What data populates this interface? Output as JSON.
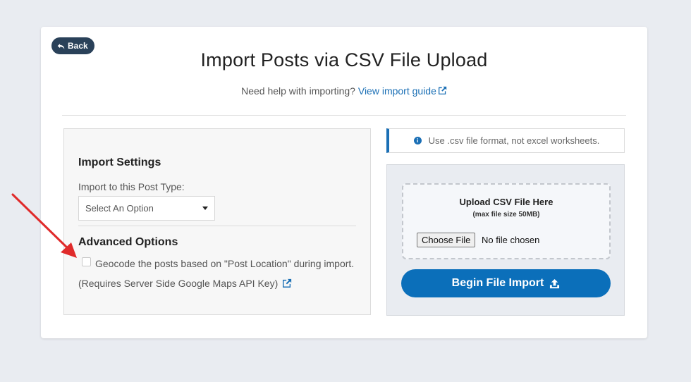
{
  "header": {
    "back_label": "Back",
    "title": "Import Posts via CSV File Upload",
    "help_text": "Need help with importing?",
    "help_link": "View import guide"
  },
  "settings": {
    "section_title": "Import Settings",
    "post_type_label": "Import to this Post Type:",
    "post_type_selected": "Select An Option"
  },
  "advanced": {
    "section_title": "Advanced Options",
    "geocode_label": "Geocode the posts based on \"Post Location\" during import. (Requires Server Side Google Maps API Key)",
    "geocode_checked": false
  },
  "info": {
    "message": "Use .csv file format, not excel worksheets."
  },
  "upload": {
    "title": "Upload CSV File Here",
    "subtitle": "(max file size 50MB)",
    "choose_label": "Choose File",
    "file_status": "No file chosen",
    "begin_label": "Begin File Import"
  },
  "colors": {
    "accent": "#0b6fba",
    "back_button": "#2a4159",
    "annotation_arrow": "#e02b2b"
  }
}
